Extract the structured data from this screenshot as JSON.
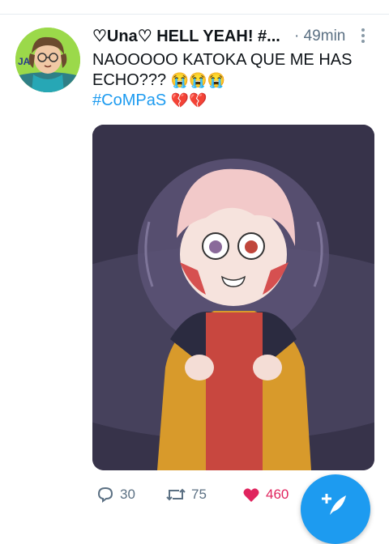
{
  "tweet": {
    "display_name": "♡Una♡ HELL YEAH! #...",
    "time": "· 49min",
    "text_line1": "NAOOOOO KATOKA QUE ME HAS",
    "text_line2": "ECHO???",
    "text_emojis": "😭😭😭",
    "hashtag": "#CoMPaS",
    "hashtag_emojis": "💔💔",
    "avatar_initials": "JA"
  },
  "actions": {
    "reply_count": "30",
    "retweet_count": "75",
    "like_count": "460"
  },
  "colors": {
    "accent": "#1d9bf0",
    "like": "#e0245e",
    "muted": "#5b7083"
  },
  "icons": {
    "more": "more-vertical-icon",
    "reply": "reply-icon",
    "retweet": "retweet-icon",
    "like": "heart-icon",
    "compose": "compose-feather-icon"
  }
}
